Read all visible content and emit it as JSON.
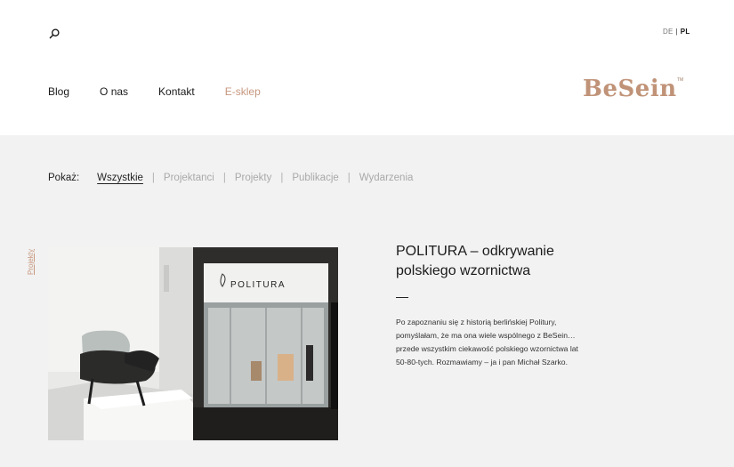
{
  "header": {
    "languages": {
      "de": "DE",
      "separator": "|",
      "pl": "PL"
    },
    "nav": [
      {
        "label": "Blog"
      },
      {
        "label": "O nas"
      },
      {
        "label": "Kontakt"
      },
      {
        "label": "E-sklep"
      }
    ],
    "logo": {
      "text": "BeSein",
      "trademark": "TM",
      "color": "#c09378"
    },
    "search_icon": "search-icon"
  },
  "filter": {
    "label": "Pokaż:",
    "items": [
      {
        "label": "Wszystkie",
        "active": true
      },
      {
        "label": "Projektanci"
      },
      {
        "label": "Projekty"
      },
      {
        "label": "Publikacje"
      },
      {
        "label": "Wydarzenia"
      }
    ],
    "separator": "|"
  },
  "post": {
    "category": "Projekty",
    "title": "POLITURA – odkrywanie polskiego wzornictwa",
    "excerpt": "Po zapoznaniu się z historią berlińskiej Politury, pomyślałam, że ma ona wiele wspólnego z BeSein… przede wszystkim ciekawość polskiego wzornictwa lat 50-80-tych. Rozmawiamy – ja i pan Michał Szarko.",
    "image": {
      "sign_text": "POLITURA"
    }
  },
  "colors": {
    "accent": "#c7977e",
    "header_bg": "#ffffff",
    "page_bg": "#f2f2f2"
  }
}
